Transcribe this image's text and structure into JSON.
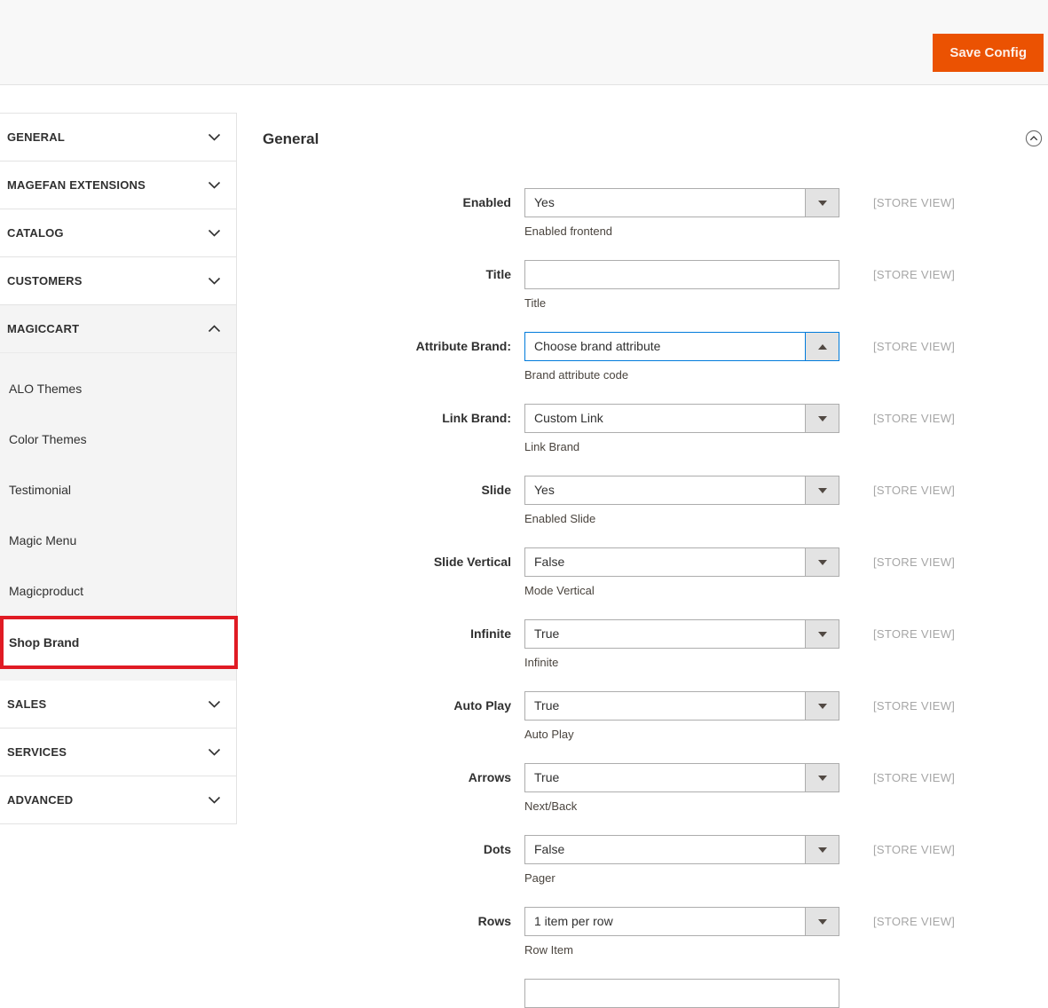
{
  "colors": {
    "accent": "#eb5202",
    "focus_border": "#007bdb",
    "highlight_border": "#e01b24"
  },
  "header": {
    "save_label": "Save Config"
  },
  "sidebar": {
    "sections": [
      {
        "label": "GENERAL",
        "state": "collapsed"
      },
      {
        "label": "MAGEFAN EXTENSIONS",
        "state": "collapsed"
      },
      {
        "label": "CATALOG",
        "state": "collapsed"
      },
      {
        "label": "CUSTOMERS",
        "state": "collapsed"
      },
      {
        "label": "MAGICCART",
        "state": "expanded",
        "items": [
          "ALO Themes",
          "Color Themes",
          "Testimonial",
          "Magic Menu",
          "Magicproduct",
          "Shop Brand"
        ],
        "selected_item": "Shop Brand"
      },
      {
        "label": "SALES",
        "state": "collapsed"
      },
      {
        "label": "SERVICES",
        "state": "collapsed"
      },
      {
        "label": "ADVANCED",
        "state": "collapsed"
      }
    ]
  },
  "main": {
    "section_title": "General",
    "fields": [
      {
        "label": "Enabled",
        "type": "select",
        "value": "Yes",
        "helper": "Enabled frontend",
        "scope": "[STORE VIEW]"
      },
      {
        "label": "Title",
        "type": "text",
        "value": "",
        "helper": "Title",
        "scope": "[STORE VIEW]"
      },
      {
        "label": "Attribute Brand:",
        "type": "select",
        "value": "Choose brand attribute",
        "helper": "Brand attribute code",
        "scope": "[STORE VIEW]",
        "focused": true,
        "open": true
      },
      {
        "label": "Link Brand:",
        "type": "select",
        "value": "Custom Link",
        "helper": "Link Brand",
        "scope": "[STORE VIEW]"
      },
      {
        "label": "Slide",
        "type": "select",
        "value": "Yes",
        "helper": "Enabled Slide",
        "scope": "[STORE VIEW]"
      },
      {
        "label": "Slide Vertical",
        "type": "select",
        "value": "False",
        "helper": "Mode Vertical",
        "scope": "[STORE VIEW]"
      },
      {
        "label": "Infinite",
        "type": "select",
        "value": "True",
        "helper": "Infinite",
        "scope": "[STORE VIEW]"
      },
      {
        "label": "Auto Play",
        "type": "select",
        "value": "True",
        "helper": "Auto Play",
        "scope": "[STORE VIEW]"
      },
      {
        "label": "Arrows",
        "type": "select",
        "value": "True",
        "helper": "Next/Back",
        "scope": "[STORE VIEW]"
      },
      {
        "label": "Dots",
        "type": "select",
        "value": "False",
        "helper": "Pager",
        "scope": "[STORE VIEW]"
      },
      {
        "label": "Rows",
        "type": "select",
        "value": "1 item per row",
        "helper": "Row Item",
        "scope": "[STORE VIEW]"
      },
      {
        "label": "",
        "type": "partial",
        "value": ""
      }
    ]
  }
}
